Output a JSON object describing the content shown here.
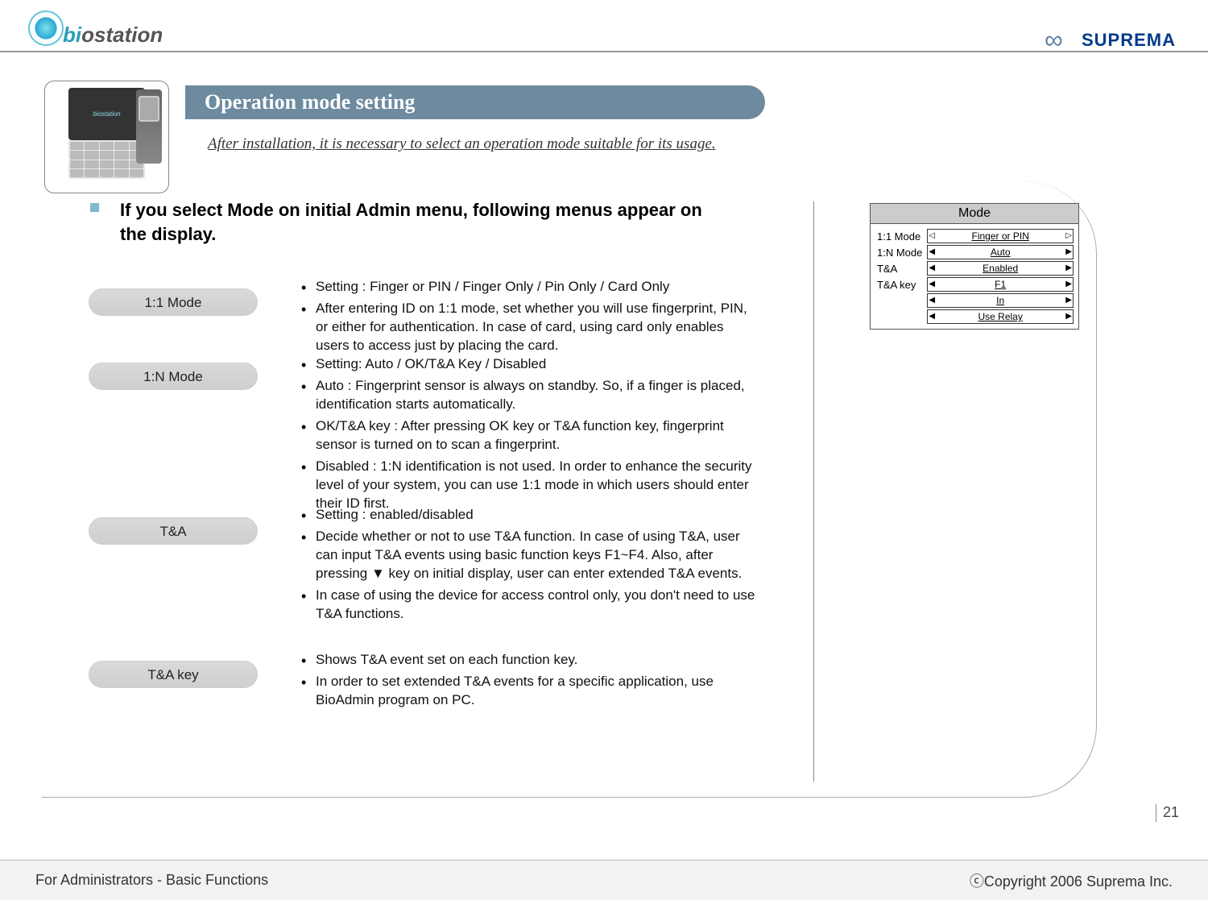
{
  "logos": {
    "biostation_bi": "bi",
    "biostation_rest": "ostation",
    "suprema": "SUPREMA"
  },
  "device_label": "biostation",
  "banner": "Operation mode setting",
  "subtitle": "After installation, it is necessary to select  an operation mode suitable for its usage.",
  "intro": "If  you select Mode on initial Admin menu, following menus appear on the display.",
  "pills": {
    "p1": "1:1 Mode",
    "p2": "1:N Mode",
    "p3": "T&A",
    "p4": "T&A key"
  },
  "sec1": [
    "Setting : Finger or PIN / Finger Only / Pin Only / Card Only",
    "After entering ID on 1:1 mode, set whether you will use fingerprint, PIN, or either for authentication. In case of card, using card only enables users to access just by placing the card."
  ],
  "sec2": [
    "Setting: Auto / OK/T&A Key / Disabled",
    "Auto : Fingerprint sensor is always on standby. So, if a finger is placed, identification starts automatically.",
    "OK/T&A key : After pressing OK key or T&A function key, fingerprint sensor is turned on to scan a fingerprint.",
    "Disabled : 1:N identification is not used. In order to enhance the security level of your system, you can use 1:1 mode in which users should enter their ID first."
  ],
  "sec3": [
    "Setting : enabled/disabled",
    "Decide whether or not to use T&A function. In case of using T&A, user can input T&A events using basic function keys F1~F4. Also, after pressing ▼ key on initial display, user can enter extended T&A events.",
    "In case of using the device for access control only, you don't need to use T&A functions."
  ],
  "sec4": [
    "Shows T&A event set on each function key.",
    "In order to set extended T&A events for a specific application, use BioAdmin program on PC."
  ],
  "panel": {
    "title": "Mode",
    "labels": [
      "1:1 Mode",
      "1:N Mode",
      "T&A",
      "T&A key"
    ],
    "values": [
      "Finger or PIN",
      "Auto",
      "Enabled",
      "F1",
      "In",
      "Use Relay"
    ]
  },
  "footer": {
    "left": "For Administrators - Basic Functions",
    "right": "ⓒCopyright 2006 Suprema Inc."
  },
  "page": "21"
}
